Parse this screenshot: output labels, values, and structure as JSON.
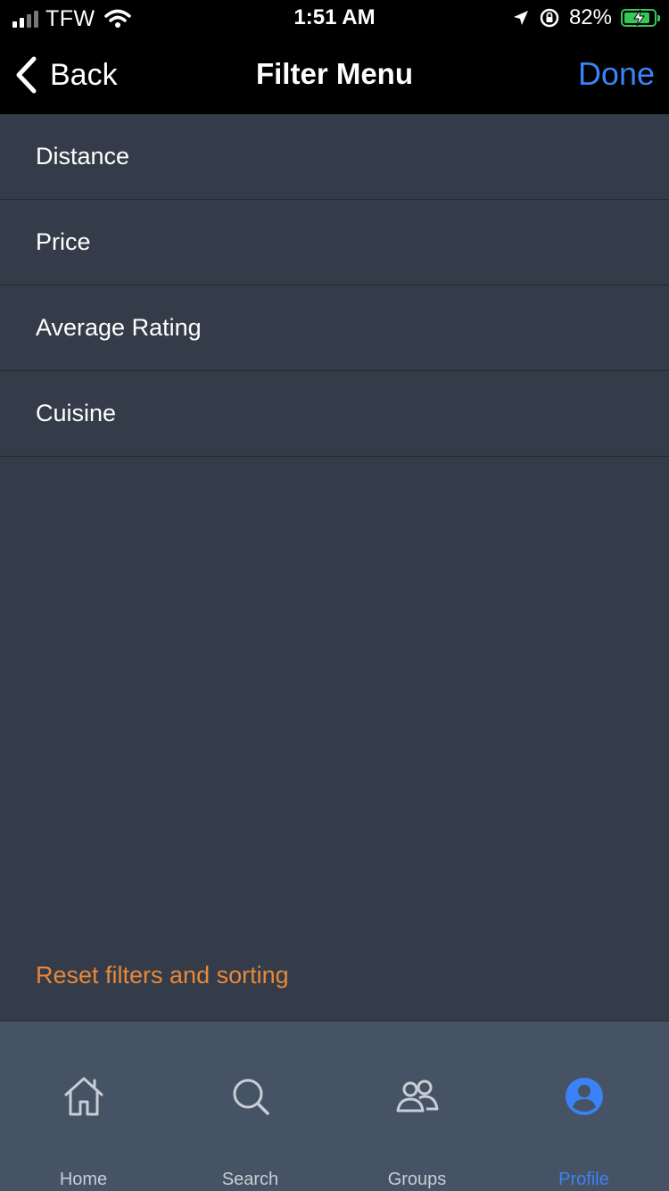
{
  "status_bar": {
    "carrier": "TFW",
    "time": "1:51 AM",
    "battery_percent": "82%",
    "battery_color": "#34c759"
  },
  "nav": {
    "back_label": "Back",
    "title": "Filter Menu",
    "done_label": "Done",
    "accent_color": "#3b82f6"
  },
  "filters": [
    {
      "label": "Distance"
    },
    {
      "label": "Price"
    },
    {
      "label": "Average Rating"
    },
    {
      "label": "Cuisine"
    }
  ],
  "reset_label": "Reset filters and sorting",
  "reset_color": "#e8883a",
  "tabs": [
    {
      "label": "Home",
      "icon": "home-icon"
    },
    {
      "label": "Search",
      "icon": "search-icon"
    },
    {
      "label": "Groups",
      "icon": "groups-icon"
    },
    {
      "label": "Profile",
      "icon": "profile-icon",
      "active": true
    }
  ]
}
